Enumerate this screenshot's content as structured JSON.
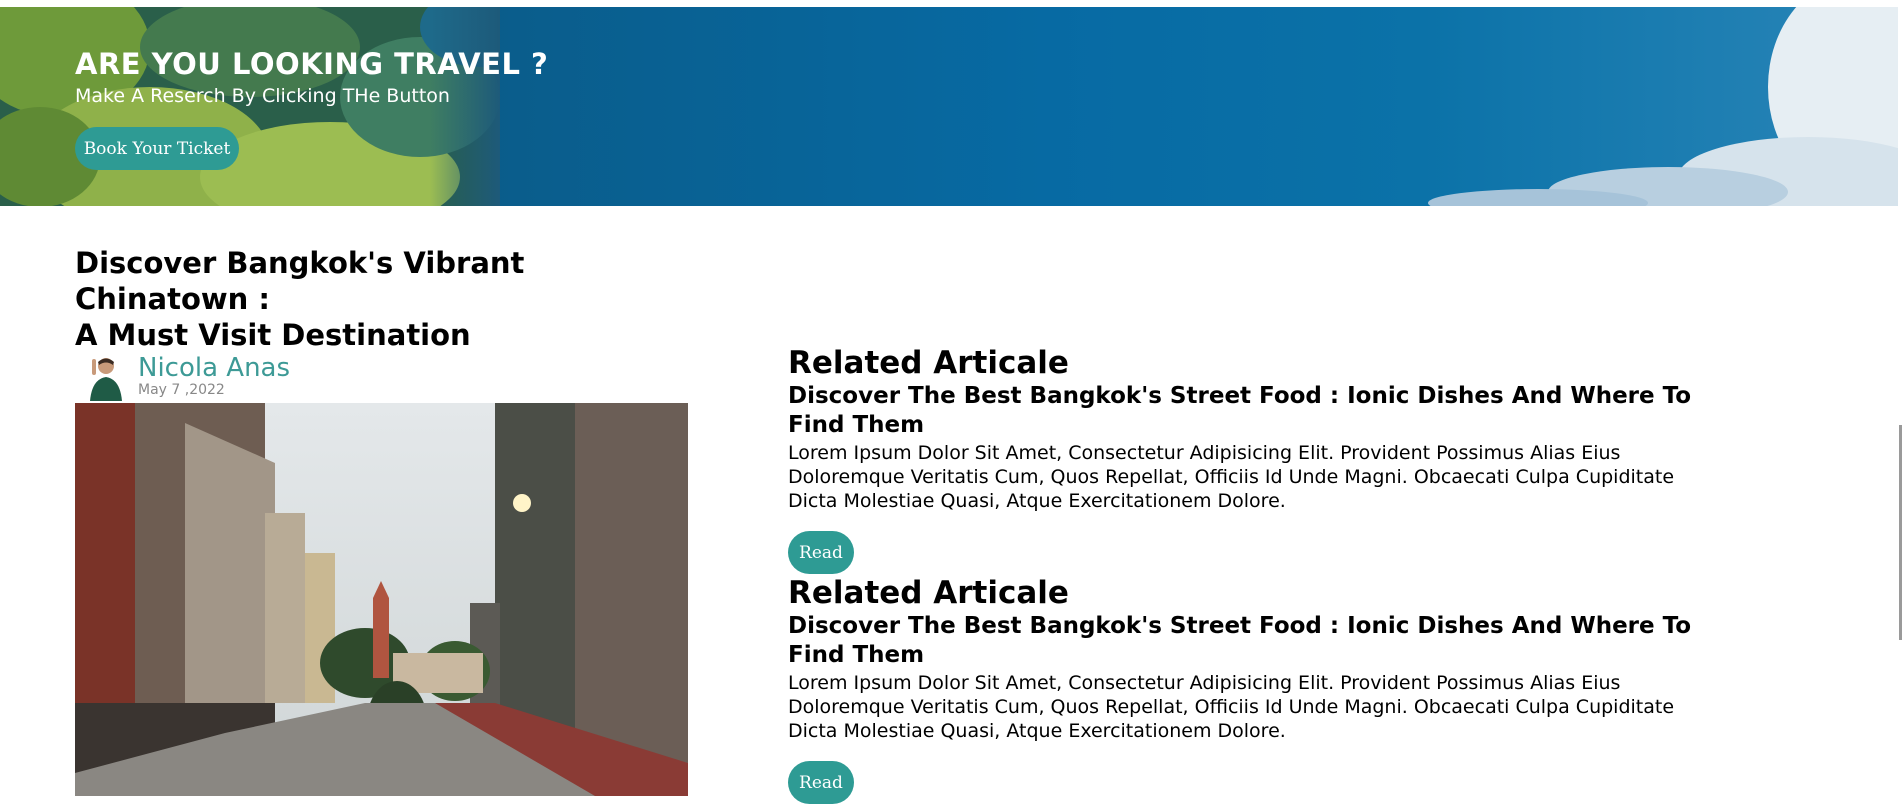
{
  "hero": {
    "title": "ARE YOU LOOKING TRAVEL ?",
    "subtitle": "Make A Reserch By Clicking THe Button",
    "button_label": "Book Your Ticket"
  },
  "article": {
    "title_line1": "Discover Bangkok's Vibrant",
    "title_line2": "Chinatown :",
    "title_line3": "A Must Visit Destination",
    "author_name": "Nicola Anas",
    "date": "May 7 ,2022"
  },
  "related": [
    {
      "heading": "Related Articale",
      "title": "Discover The Best Bangkok's Street Food : Ionic Dishes And Where To Find Them",
      "body": "Lorem Ipsum Dolor Sit Amet, Consectetur Adipisicing Elit. Provident Possimus Alias Eius Doloremque Veritatis Cum, Quos Repellat, Officiis Id Unde Magni. Obcaecati Culpa Cupiditate Dicta Molestiae Quasi, Atque Exercitationem Dolore.",
      "button_label": "Read"
    },
    {
      "heading": "Related Articale",
      "title": "Discover The Best Bangkok's Street Food : Ionic Dishes And Where To Find Them",
      "body": "Lorem Ipsum Dolor Sit Amet, Consectetur Adipisicing Elit. Provident Possimus Alias Eius Doloremque Veritatis Cum, Quos Repellat, Officiis Id Unde Magni. Obcaecati Culpa Cupiditate Dicta Molestiae Quasi, Atque Exercitationem Dolore.",
      "button_label": "Read"
    }
  ],
  "colors": {
    "accent": "#2e9b94",
    "author_name": "#3d9a96",
    "hero_blue": "#076aa3"
  }
}
